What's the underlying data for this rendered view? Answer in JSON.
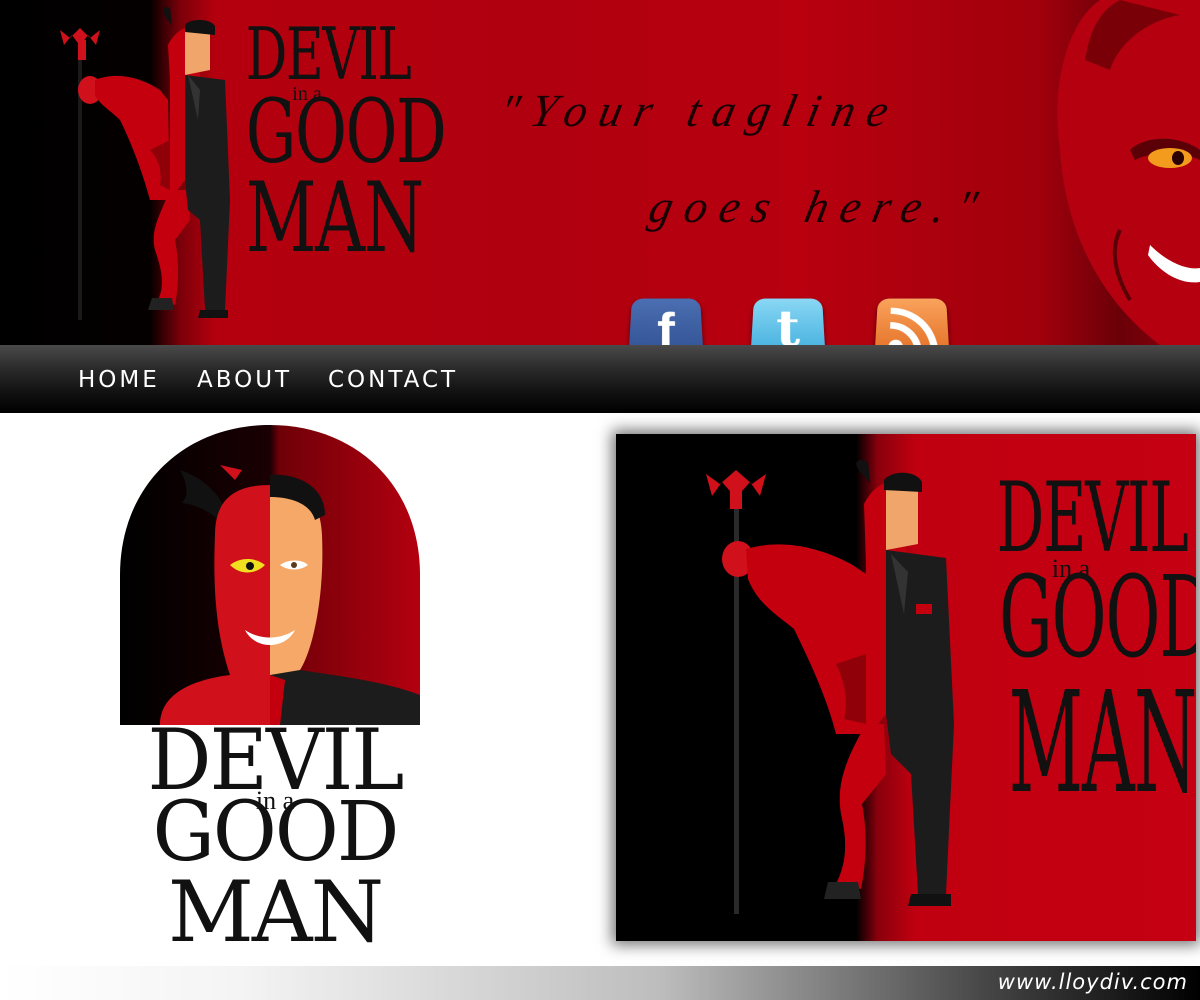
{
  "header": {
    "logo": {
      "line1": "DEVIL",
      "line2": "in a",
      "line3": "GOOD",
      "line4": "MAN"
    },
    "tagline_line1": "\"Your tagline",
    "tagline_line2": "goes here.\"",
    "social_icons": [
      {
        "name": "facebook-icon",
        "glyph": "f"
      },
      {
        "name": "twitter-icon",
        "glyph": "t"
      },
      {
        "name": "rss-icon",
        "glyph": "RSS"
      }
    ]
  },
  "nav": {
    "items": [
      {
        "label": "HOME"
      },
      {
        "label": "ABOUT"
      },
      {
        "label": "CONTACT"
      }
    ]
  },
  "main": {
    "oval_logo": {
      "line1": "DEVIL",
      "line2": "in a",
      "line3": "GOOD",
      "line4": "MAN"
    },
    "poster_logo": {
      "line1": "DEVIL",
      "line2": "in a",
      "line3": "GOOD",
      "line4": "MAN"
    }
  },
  "footer": {
    "url": "www.lloydiv.com"
  },
  "colors": {
    "brand_red": "#b8000f",
    "nav_black": "#111111",
    "devil_skin": "#d0101a"
  }
}
